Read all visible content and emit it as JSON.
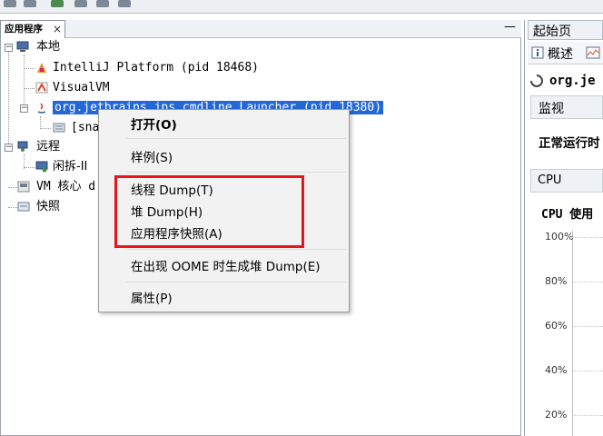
{
  "tree_panel": {
    "tab_label": "应用程序",
    "tab_close": "×",
    "minimize": "—",
    "nodes": {
      "local": "本地",
      "intellij": "IntelliJ Platform (pid 18468)",
      "visualvm": "VisualVM",
      "launcher": "org.jetbrains.jps.cmdline.Launcher (pid 18380)",
      "snapshot": "[sna",
      "remote": "远程",
      "remote_child": "闲拆-II",
      "vm_core": "VM 核心 d",
      "snapshots": "快照"
    }
  },
  "context_menu": {
    "items": [
      "打开(O)",
      "样例(S)",
      "线程 Dump(T)",
      "堆 Dump(H)",
      "应用程序快照(A)",
      "在出现 OOME 时生成堆 Dump(E)",
      "属性(P)"
    ],
    "highlight_color": "#e8151b"
  },
  "right_panel": {
    "tab_label": "起始页",
    "subtab_overview": "概述",
    "header_title": "org.je",
    "monitor_label": "监视",
    "uptime_label": "正常运行时",
    "cpu_tab": "CPU",
    "cpu_usage_label": "CPU 使用",
    "y_ticks": [
      "100%",
      "80%",
      "60%",
      "40%",
      "20%"
    ]
  },
  "colors": {
    "selection": "#2468d8",
    "highlight_box": "#e8151b"
  }
}
